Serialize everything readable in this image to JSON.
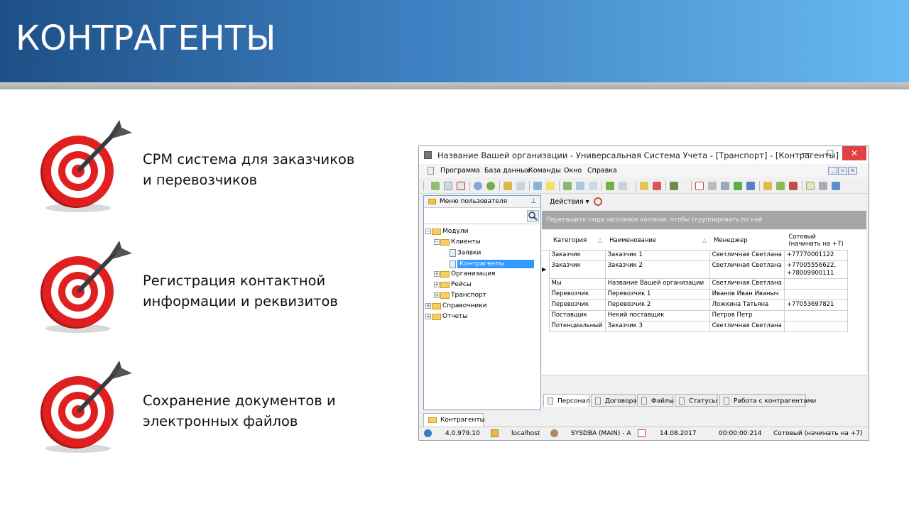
{
  "slide": {
    "title": "КОНТРАГЕНТЫ",
    "bullets": [
      {
        "line1": "CPM система для заказчиков",
        "line2": "и перевозчиков"
      },
      {
        "line1": "Регистрация контактной",
        "line2": "информации и реквизитов"
      },
      {
        "line1": "Сохранение документов и",
        "line2": "электронных файлов"
      }
    ]
  },
  "window": {
    "title": "Название Вашей организации - Универсальная Система Учета - [Транспорт] - [Контрагенты]",
    "controls": {
      "minimize": "—",
      "maximize": "☐",
      "close": "✕"
    },
    "menu": [
      "Программа",
      "База данных",
      "Команды",
      "Окно",
      "Справка"
    ]
  },
  "left_pane": {
    "header": "Меню пользователя",
    "tree": [
      {
        "label": "Модули",
        "expander": "−"
      },
      {
        "label": "Клиенты",
        "expander": "−"
      },
      {
        "label": "Заявки",
        "expander": ""
      },
      {
        "label": "Контрагенты",
        "expander": ""
      },
      {
        "label": "Организация",
        "expander": "+"
      },
      {
        "label": "Рейсы",
        "expander": "+"
      },
      {
        "label": "Транспорт",
        "expander": "+"
      },
      {
        "label": "Справочники",
        "expander": "+"
      },
      {
        "label": "Отчеты",
        "expander": "+"
      }
    ]
  },
  "actions_label": "Действия ▾",
  "group_hint": "Перетащите сюда заголовок колонки, чтобы сгруппировать по ней",
  "grid": {
    "columns": {
      "category": "Категория",
      "name": "Наименование",
      "manager": "Менеджер",
      "phone_1": "Сотовый",
      "phone_2": "(начинать на +7)"
    },
    "sort_glyph": "△",
    "row_pointer": "▶",
    "rows": [
      {
        "category": "Заказчик",
        "name": "Заказчик 1",
        "manager": "Светличная Светлана",
        "phone1": "+77770001122",
        "phone2": ""
      },
      {
        "category": "Заказчик",
        "name": "Заказчик 2",
        "manager": "Светличная Светлана",
        "phone1": "+77005556622,",
        "phone2": "+78009900111"
      },
      {
        "category": "Мы",
        "name": "Название Вашей организации",
        "manager": "Светличная Светлана",
        "phone1": "",
        "phone2": ""
      },
      {
        "category": "Перевозчик",
        "name": "Перевозчик 1",
        "manager": "Иванов Иван Иваныч",
        "phone1": "",
        "phone2": ""
      },
      {
        "category": "Перевозчик",
        "name": "Перевозчик 2",
        "manager": "Ложкина Татьяна",
        "phone1": "+77053697821",
        "phone2": ""
      },
      {
        "category": "Поставщик",
        "name": "Некий поставщик",
        "manager": "Петров Петр",
        "phone1": "",
        "phone2": ""
      },
      {
        "category": "Потенциальный",
        "name": "Заказчик 3",
        "manager": "Светличная Светлана",
        "phone1": "",
        "phone2": ""
      }
    ]
  },
  "tabs": [
    "Персонал",
    "Договора",
    "Файлы",
    "Статусы",
    "Работа с контрагентами"
  ],
  "doc_tab": "Контрагенты",
  "status": {
    "version": "4.0.979.10",
    "host": "localhost",
    "user": "SYSDBA (MAIN) - A",
    "date": "14.08.2017",
    "time": "00:00:00:214",
    "field": "Сотовый (начинать на +7)"
  },
  "colors": {
    "banner_start": "#1e4f86",
    "banner_end": "#69b9f2",
    "close_button": "#e04343",
    "selection": "#3399ff",
    "group_bar": "#a6a6a6"
  }
}
